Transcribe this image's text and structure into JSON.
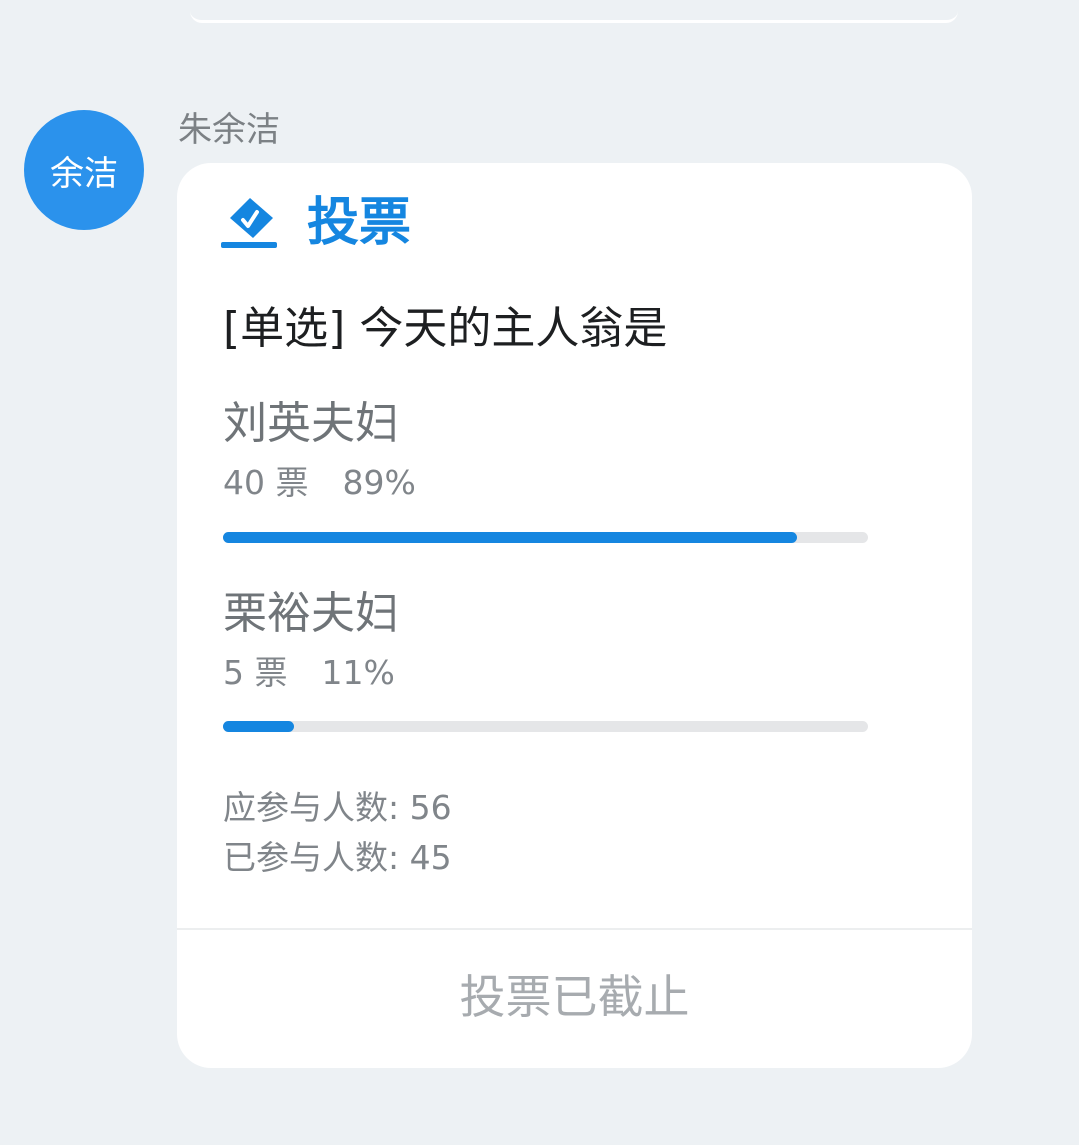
{
  "sender": {
    "avatar_text": "余洁",
    "avatar_color": "#2b92ec",
    "name": "朱余洁"
  },
  "poll": {
    "title": "投票",
    "icon": "ballot-box-icon",
    "accent_color": "#1586e0",
    "question": "[单选] 今天的主人翁是",
    "options": [
      {
        "label": "刘英夫妇",
        "votes_text": "40 票",
        "percent_text": "89%",
        "fraction": 0.89
      },
      {
        "label": "栗裕夫妇",
        "votes_text": "5 票",
        "percent_text": "11%",
        "fraction": 0.11
      }
    ],
    "expected_participants": "应参与人数: 56",
    "actual_participants": "已参与人数: 45",
    "status": "投票已截止"
  }
}
